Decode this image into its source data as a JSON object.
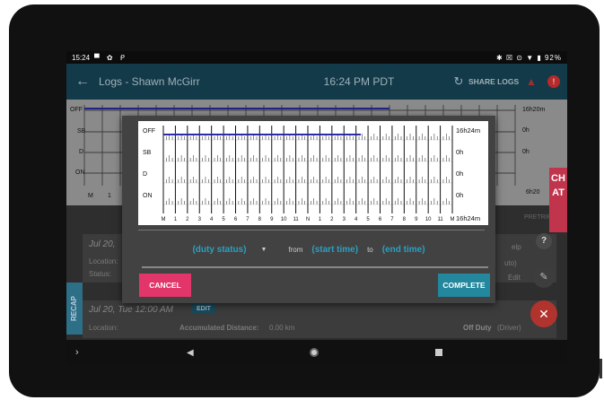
{
  "status_bar": {
    "time": "15:24",
    "icons_left": "▀ ✿ ᑭ",
    "icons_right": "✱ ☒ ⊙ ▼ ▮ 92%"
  },
  "app_bar": {
    "title": "Logs - Shawn McGirr",
    "time": "16:24 PM PDT",
    "share_label": "SHARE LOGS",
    "back_icon": "arrow-left",
    "refresh_icon": "refresh"
  },
  "background_graph": {
    "row_labels": [
      "OFF",
      "SB",
      "D",
      "ON"
    ],
    "totals": [
      "16h20m",
      "0h",
      "0h",
      "6h20"
    ],
    "hour_labels": [
      "M",
      "1"
    ]
  },
  "background_log": {
    "entry1_date": "Jul 20,",
    "location_label": "Location:",
    "status_label": "Status:",
    "auto_text": "uto)",
    "edit_text": "Edit",
    "help_text": "elp",
    "pretrip_text": "PRETRIP",
    "entry2_date": "Jul 20, Tue 12:00 AM",
    "edit_chip": "EDIT",
    "entry2_location": "Location:",
    "accumulated_distance_label": "Accumulated Distance:",
    "accumulated_distance_value": "0.00 km",
    "entry2_status": "Off Duty",
    "entry2_role": "(Driver)"
  },
  "side_tabs": {
    "chat": "CHAT",
    "recap": "RECAP"
  },
  "dialog": {
    "graph": {
      "row_labels": [
        "OFF",
        "SB",
        "D",
        "ON"
      ],
      "totals": [
        "16h24m",
        "0h",
        "0h",
        "0h"
      ],
      "grand_total": "16h24m",
      "hour_labels": [
        "M",
        "1",
        "2",
        "3",
        "4",
        "5",
        "6",
        "7",
        "8",
        "9",
        "10",
        "11",
        "N",
        "1",
        "2",
        "3",
        "4",
        "5",
        "6",
        "7",
        "8",
        "9",
        "10",
        "11",
        "M"
      ]
    },
    "duty_status_placeholder": "(duty status)",
    "from_label": "from",
    "start_time_placeholder": "(start time)",
    "to_label": "to",
    "end_time_placeholder": "(end time)",
    "cancel_label": "CANCEL",
    "complete_label": "COMPLETE"
  },
  "colors": {
    "app_bar": "#133a49",
    "duty_line": "#2a2aaa",
    "cancel": "#e2356a",
    "complete": "#23879d",
    "link": "#2aa0c0",
    "chat_tab": "#c0344c"
  },
  "chart_data": {
    "type": "line",
    "title": "",
    "rows": [
      "OFF",
      "SB",
      "D",
      "ON"
    ],
    "x_ticks": [
      "M",
      "1",
      "2",
      "3",
      "4",
      "5",
      "6",
      "7",
      "8",
      "9",
      "10",
      "11",
      "N",
      "1",
      "2",
      "3",
      "4",
      "5",
      "6",
      "7",
      "8",
      "9",
      "10",
      "11",
      "M"
    ],
    "xlim": [
      0,
      24
    ],
    "series": [
      {
        "status": "OFF",
        "segments": [
          {
            "start_hour": 0,
            "end_hour": 16.4
          }
        ]
      }
    ],
    "totals": {
      "OFF": "16h24m",
      "SB": "0h",
      "D": "0h",
      "ON": "0h"
    },
    "grand_total": "16h24m"
  }
}
